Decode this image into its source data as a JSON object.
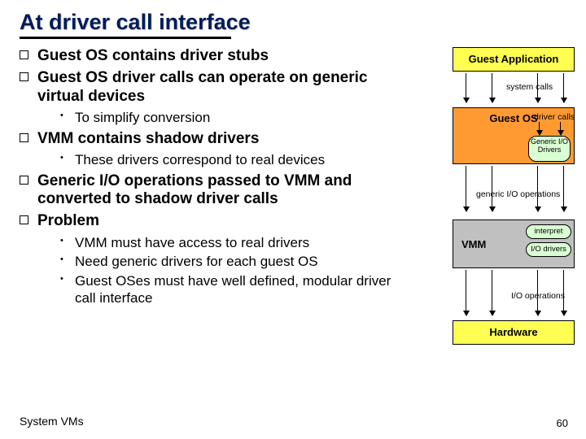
{
  "title": "At driver call interface",
  "bullets": {
    "b1": "Guest OS contains driver stubs",
    "b2": "Guest OS driver calls can operate on generic  virtual devices",
    "b2_1": "To simplify conversion",
    "b3": "VMM contains shadow drivers",
    "b3_1": "These drivers correspond to real devices",
    "b4": "Generic I/O operations passed to VMM and converted to shadow driver calls",
    "b5": "Problem",
    "b5_1": "VMM must have access to real drivers",
    "b5_2": "Need generic drivers for each guest OS",
    "b5_3": "Guest OSes must have well defined, modular driver call interface"
  },
  "diagram": {
    "guest_app": "Guest Application",
    "system_calls": "system calls",
    "guest_os": "Guest OS",
    "driver_calls": "driver calls",
    "generic_io_drivers_l1": "Generic I/O",
    "generic_io_drivers_l2": "Drivers",
    "generic_io_ops": "generic I/O operations",
    "vmm": "VMM",
    "interpret": "interpret",
    "io_drivers": "I/O drivers",
    "io_operations": "I/O operations",
    "hardware": "Hardware"
  },
  "footer": {
    "left": "System VMs",
    "page": "60"
  }
}
